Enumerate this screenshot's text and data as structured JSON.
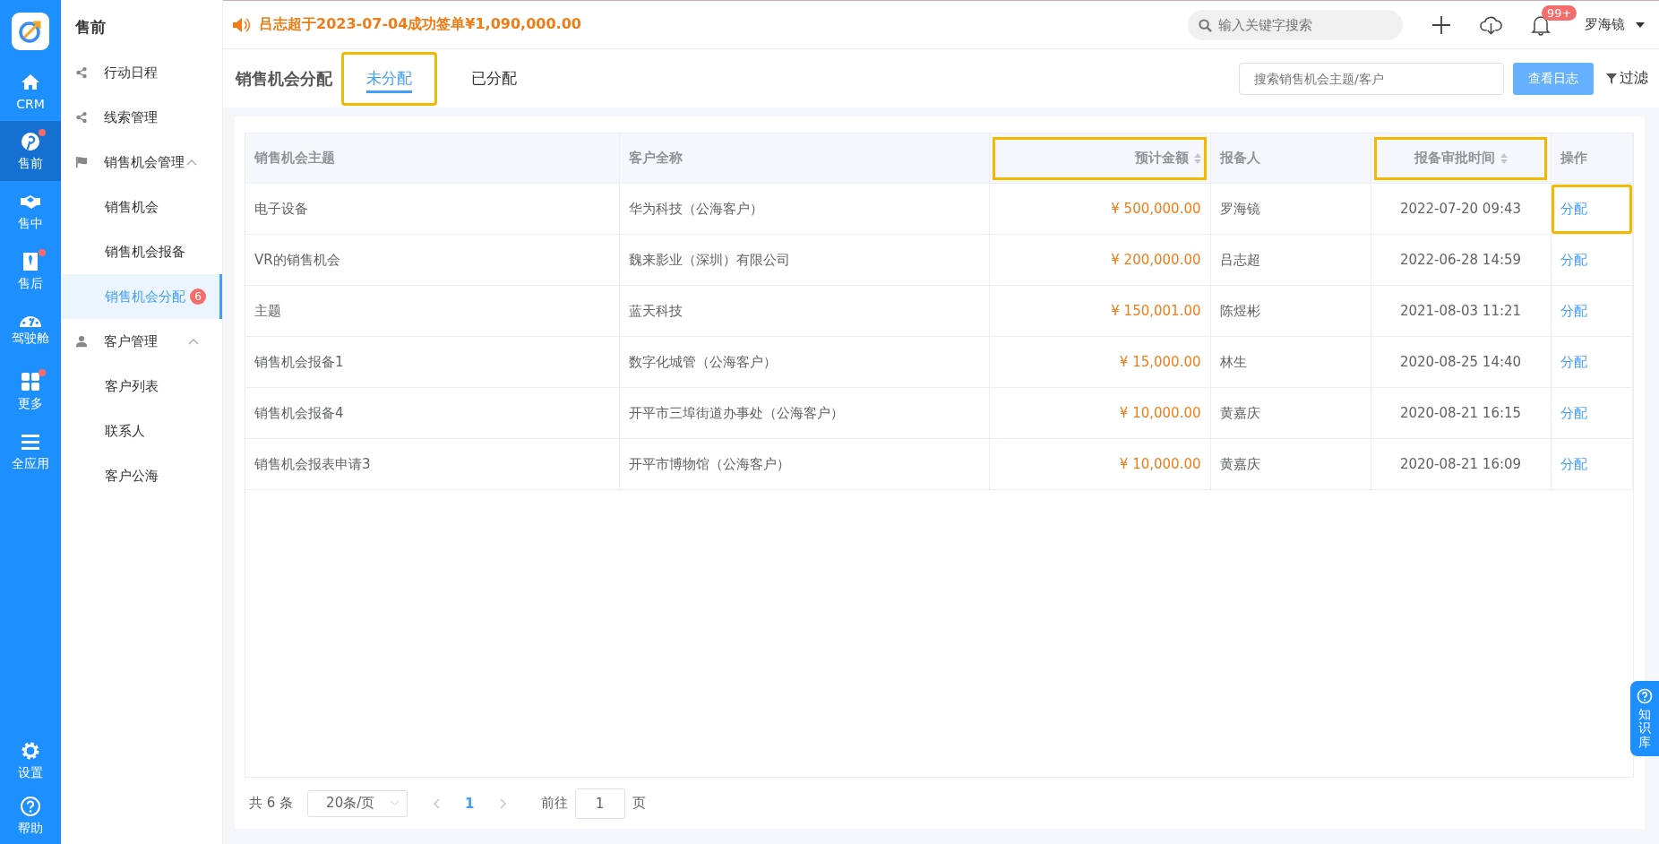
{
  "nav": {
    "items": [
      {
        "label": "CRM",
        "kind": "home",
        "selected": false,
        "dot": false
      },
      {
        "label": "售前",
        "kind": "pin",
        "selected": true,
        "dot": true
      },
      {
        "label": "售中",
        "kind": "handshake",
        "selected": false,
        "dot": false
      },
      {
        "label": "售后",
        "kind": "tie",
        "selected": false,
        "dot": true
      },
      {
        "label": "驾驶舱",
        "kind": "gauge",
        "selected": false,
        "dot": false
      },
      {
        "label": "更多",
        "kind": "grid",
        "selected": false,
        "dot": true
      },
      {
        "label": "全应用",
        "kind": "menu",
        "selected": false,
        "dot": false
      }
    ],
    "bottom": [
      {
        "label": "设置",
        "kind": "gear"
      },
      {
        "label": "帮助",
        "kind": "help"
      }
    ]
  },
  "menu": {
    "title": "售前",
    "items": [
      {
        "label": "行动日程",
        "kind": "share",
        "selected": false
      },
      {
        "label": "线索管理",
        "kind": "share",
        "selected": false
      },
      {
        "label": "销售机会管理",
        "kind": "flag",
        "selected": false,
        "expanded": true,
        "children": [
          {
            "label": "销售机会",
            "selected": false
          },
          {
            "label": "销售机会报备",
            "selected": false
          },
          {
            "label": "销售机会分配",
            "selected": true,
            "badge": "6"
          }
        ]
      },
      {
        "label": "客户管理",
        "kind": "user",
        "selected": false,
        "expanded": true,
        "children": [
          {
            "label": "客户列表",
            "selected": false
          },
          {
            "label": "联系人",
            "selected": false
          },
          {
            "label": "客户公海",
            "selected": false
          }
        ]
      }
    ]
  },
  "topbar": {
    "notice": "吕志超于2023-07-04成功签单¥1,090,000.00",
    "search_placeholder": "输入关键字搜索",
    "bell_badge": "99+",
    "user": "罗海镜"
  },
  "page": {
    "title": "销售机会分配",
    "tabs": [
      {
        "label": "未分配",
        "selected": true,
        "highlighted": true
      },
      {
        "label": "已分配",
        "selected": false,
        "highlighted": false
      }
    ],
    "search_placeholder": "搜索销售机会主题/客户",
    "log_button": "查看日志",
    "filter": "过滤"
  },
  "table": {
    "columns": [
      {
        "label": "销售机会主题",
        "kind": "text",
        "sortable": false,
        "highlighted": false
      },
      {
        "label": "客户全称",
        "kind": "text",
        "sortable": false,
        "highlighted": false
      },
      {
        "label": "预计金额",
        "kind": "amount",
        "sortable": true,
        "highlighted": true
      },
      {
        "label": "报备人",
        "kind": "text",
        "sortable": false,
        "highlighted": false
      },
      {
        "label": "报备审批时间",
        "kind": "time",
        "sortable": true,
        "highlighted": true
      },
      {
        "label": "操作",
        "kind": "action",
        "sortable": false,
        "highlighted": false
      }
    ],
    "rows": [
      {
        "cells": [
          "电子设备",
          "华为科技（公海客户）",
          "¥ 500,000.00",
          "罗海镜",
          "2022-07-20 09:43",
          "分配"
        ],
        "highlighted": true
      },
      {
        "cells": [
          "VR的销售机会",
          "魏来影业（深圳）有限公司",
          "¥ 200,000.00",
          "吕志超",
          "2022-06-28 14:59",
          "分配"
        ],
        "highlighted": false
      },
      {
        "cells": [
          "主题",
          "蓝天科技",
          "¥ 150,001.00",
          "陈煜彬",
          "2021-08-03 11:21",
          "分配"
        ],
        "highlighted": false
      },
      {
        "cells": [
          "销售机会报备1",
          "数字化城管（公海客户）",
          "¥ 15,000.00",
          "林生",
          "2020-08-25 14:40",
          "分配"
        ],
        "highlighted": false
      },
      {
        "cells": [
          "销售机会报备4",
          "开平市三埠街道办事处（公海客户）",
          "¥ 10,000.00",
          "黄嘉庆",
          "2020-08-21 16:15",
          "分配"
        ],
        "highlighted": false
      },
      {
        "cells": [
          "销售机会报表申请3",
          "开平市博物馆（公海客户）",
          "¥ 10,000.00",
          "黄嘉庆",
          "2020-08-21 16:09",
          "分配"
        ],
        "highlighted": false
      }
    ]
  },
  "pagination": {
    "total": "共 6 条",
    "page_size": "20条/页",
    "current": "1",
    "goto_label": "前往",
    "goto_value": "1",
    "page_unit": "页"
  },
  "help_tab": "知识库"
}
